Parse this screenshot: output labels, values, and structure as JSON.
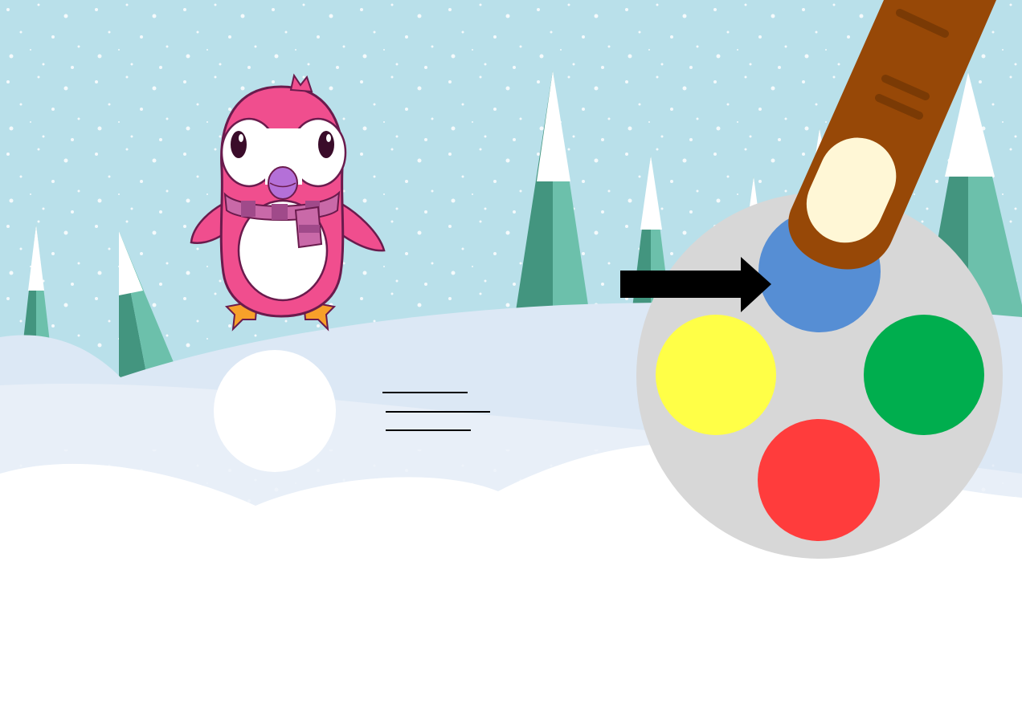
{
  "scene": {
    "theme": "winter",
    "colors": {
      "sky": "#b9e0ea",
      "snow_far": "#dce8f5",
      "snow_mid": "#e8eff8",
      "snow_near": "#ffffff",
      "tree_dark": "#43957f",
      "tree_light": "#6cc0ab",
      "tree_snow": "#ffffff"
    }
  },
  "character": {
    "icon": "penguin-icon",
    "colors": {
      "body": "#f04e8e",
      "belly": "#ffffff",
      "scarf": "#b0559a",
      "beak": "#b470d8",
      "feet": "#f7a02a",
      "outline": "#6a1b4d"
    }
  },
  "answer_circle": {
    "icon": "empty-circle-icon",
    "color": "#ffffff"
  },
  "speed_lines": {
    "icon": "motion-lines-icon",
    "color": "#000000"
  },
  "palette": {
    "icon": "color-palette-icon",
    "background": "#d7d7d7",
    "swatches": [
      {
        "id": "blue",
        "name": "blue-swatch",
        "color": "#568ed4"
      },
      {
        "id": "yellow",
        "name": "yellow-swatch",
        "color": "#ffff47"
      },
      {
        "id": "green",
        "name": "green-swatch",
        "color": "#00ae4e"
      },
      {
        "id": "red",
        "name": "red-swatch",
        "color": "#ff3c3c"
      }
    ],
    "selected": "blue"
  },
  "pointer": {
    "icon": "pointing-finger-icon",
    "skin": "#974807",
    "nail": "#fff7d6"
  },
  "hint_arrow": {
    "icon": "right-arrow-icon",
    "color": "#000000"
  }
}
